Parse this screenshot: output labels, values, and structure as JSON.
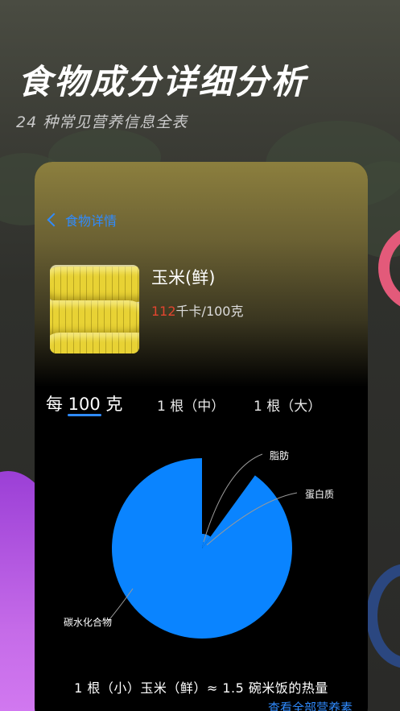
{
  "hero": {
    "title": "食物成分详细分析",
    "subtitle": "24 种常见营养信息全表"
  },
  "nav": {
    "back_label": "食物详情"
  },
  "food": {
    "name": "玉米(鲜)",
    "calories_value": "112",
    "calories_unit": "千卡/100克"
  },
  "tabs": [
    {
      "label": "每 100 克",
      "active": true
    },
    {
      "label": "1 根（中）",
      "active": false
    },
    {
      "label": "1 根（大）",
      "active": false
    }
  ],
  "chart_data": {
    "type": "pie",
    "labels": [
      "碳水化合物",
      "蛋白质",
      "脂肪"
    ],
    "values": [
      0.9,
      0.065,
      0.035
    ],
    "colors": [
      "#0a84ff",
      "#0a84ff",
      "#0a84ff"
    ]
  },
  "summary": {
    "text": "1 根（小）玉米（鲜）≈ 1.5 碗米饭的热量",
    "view_all": "查看全部营养素"
  },
  "colors": {
    "accent": "#2f8bff",
    "calorie": "#e2452f"
  }
}
